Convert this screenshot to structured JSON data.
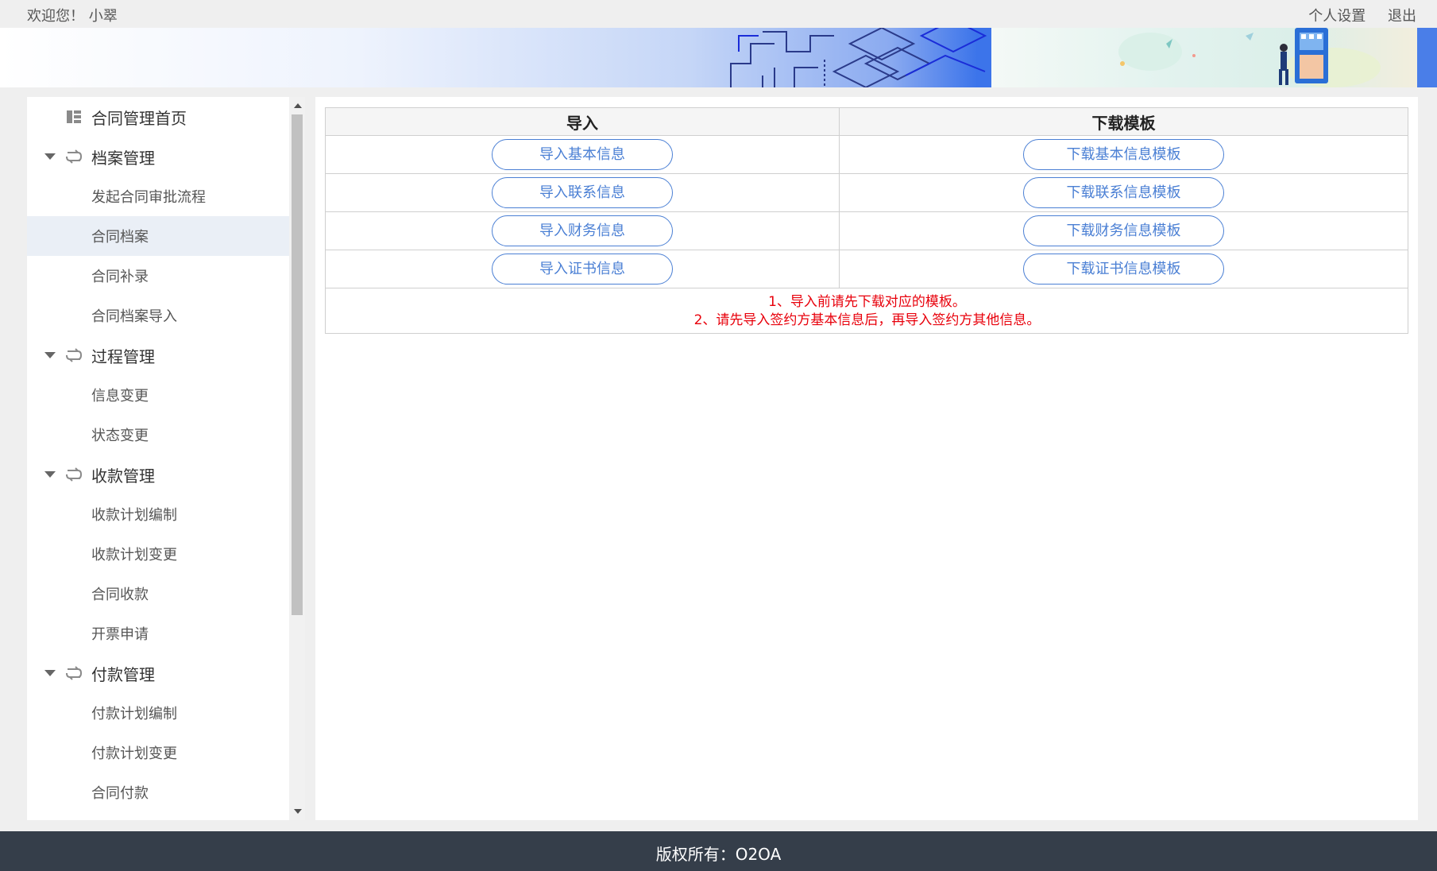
{
  "header": {
    "welcome": "欢迎您！ 小翠",
    "links": [
      "个人设置",
      "退出"
    ]
  },
  "sidebar": {
    "items": [
      {
        "label": "合同管理首页",
        "kind": "top",
        "icon": "dashboard-icon"
      },
      {
        "label": "档案管理",
        "kind": "group",
        "icon": "workflow-icon"
      },
      {
        "label": "发起合同审批流程",
        "kind": "child"
      },
      {
        "label": "合同档案",
        "kind": "child",
        "active": true
      },
      {
        "label": "合同补录",
        "kind": "child"
      },
      {
        "label": "合同档案导入",
        "kind": "child"
      },
      {
        "label": "过程管理",
        "kind": "group",
        "icon": "workflow-icon"
      },
      {
        "label": "信息变更",
        "kind": "child"
      },
      {
        "label": "状态变更",
        "kind": "child"
      },
      {
        "label": "收款管理",
        "kind": "group",
        "icon": "workflow-icon"
      },
      {
        "label": "收款计划编制",
        "kind": "child"
      },
      {
        "label": "收款计划变更",
        "kind": "child"
      },
      {
        "label": "合同收款",
        "kind": "child"
      },
      {
        "label": "开票申请",
        "kind": "child"
      },
      {
        "label": "付款管理",
        "kind": "group",
        "icon": "workflow-icon"
      },
      {
        "label": "付款计划编制",
        "kind": "child"
      },
      {
        "label": "付款计划变更",
        "kind": "child"
      },
      {
        "label": "合同付款",
        "kind": "child"
      }
    ]
  },
  "main": {
    "headers": {
      "import": "导入",
      "download": "下载模板"
    },
    "rows": [
      {
        "import": "导入基本信息",
        "download": "下载基本信息模板"
      },
      {
        "import": "导入联系信息",
        "download": "下载联系信息模板"
      },
      {
        "import": "导入财务信息",
        "download": "下载财务信息模板"
      },
      {
        "import": "导入证书信息",
        "download": "下载证书信息模板"
      }
    ],
    "notes": [
      "1、导入前请先下载对应的模板。",
      "2、请先导入签约方基本信息后，再导入签约方其他信息。"
    ]
  },
  "footer": {
    "text": "版权所有：O2OA"
  },
  "colors": {
    "accent": "#4a7fd4",
    "note": "#e8000b",
    "footer_bg": "#353e4a",
    "active_bg": "#eaeff6"
  }
}
